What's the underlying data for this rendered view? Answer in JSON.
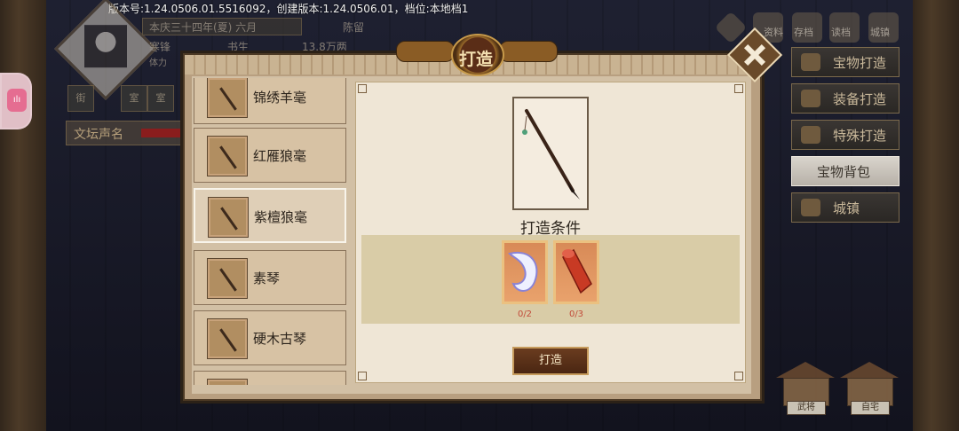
{
  "version_line": "版本号:1.24.0506.01.5516092，创建版本:1.24.0506.01，档位:本地档1",
  "player": {
    "date": "本庆三十四年(夏) 六月",
    "name": "陈留",
    "role_left": "寒锋",
    "role_title": "书生",
    "money": "13.8万两",
    "power_label": "体力",
    "small_labels": [
      "街",
      "室",
      "室"
    ],
    "fame_label": "文坛声名"
  },
  "top_icons": [
    "资料",
    "存档",
    "读档",
    "城镇"
  ],
  "right_menu": [
    {
      "label": "宝物打造",
      "icon": "forge-treasure-icon",
      "active": false
    },
    {
      "label": "装备打造",
      "icon": "forge-equip-icon",
      "active": false
    },
    {
      "label": "特殊打造",
      "icon": "wrench-icon",
      "active": false
    },
    {
      "label": "宝物背包",
      "icon": "",
      "active": true
    },
    {
      "label": "城镇",
      "icon": "town-icon",
      "active": false
    }
  ],
  "buildings": [
    "武将",
    "自宅"
  ],
  "dialog": {
    "title": "打造",
    "items": [
      {
        "name": "锦绣羊毫",
        "icon": "brush-icon",
        "selected": false
      },
      {
        "name": "红雁狼毫",
        "icon": "brush-icon",
        "selected": false
      },
      {
        "name": "紫檀狼毫",
        "icon": "brush-icon",
        "selected": true
      },
      {
        "name": "素琴",
        "icon": "zither-icon",
        "selected": false
      },
      {
        "name": "硬木古琴",
        "icon": "zither-icon",
        "selected": false
      }
    ],
    "condition_title": "打造条件",
    "materials": [
      {
        "icon": "feather-icon",
        "count": "0/2"
      },
      {
        "icon": "red-wood-icon",
        "count": "0/3"
      }
    ],
    "forge_button": "打造",
    "colors": {
      "frame": "#b89f80",
      "panel": "#efe6d6",
      "strip": "#d9cca7",
      "button": "#4a2612"
    }
  }
}
